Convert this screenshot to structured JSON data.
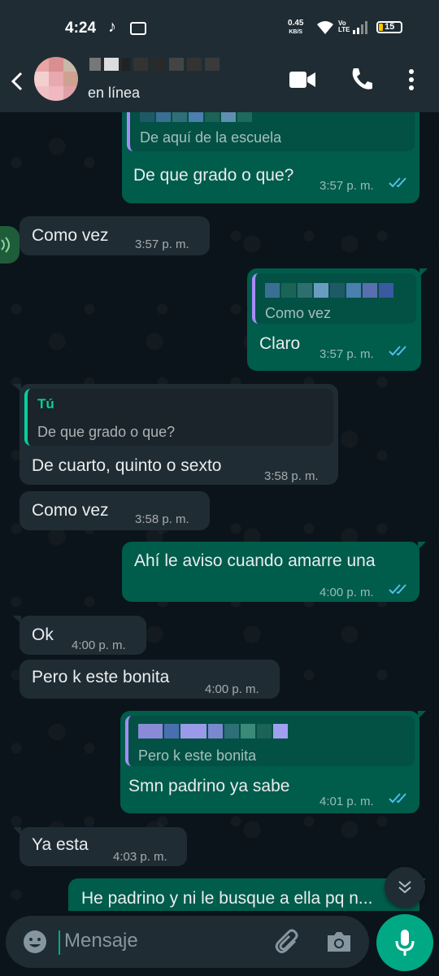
{
  "status_bar": {
    "time": "4:24",
    "net_speed_value": "0.45",
    "net_speed_unit": "KB/S",
    "volte": "Vo LTE",
    "battery": "15"
  },
  "header": {
    "status": "en línea",
    "icons": [
      "back-arrow-icon",
      "video-call-icon",
      "phone-icon",
      "more-vert-icon"
    ]
  },
  "messages": [
    {
      "dir": "out",
      "quote_text": "De aquí de la escuela",
      "text": "De que grado o que?",
      "time": "3:57 p. m.",
      "read": true
    },
    {
      "dir": "in",
      "text": "Como vez",
      "time": "3:57 p. m."
    },
    {
      "dir": "out",
      "quote_text": "Como vez",
      "text": "Claro",
      "time": "3:57 p. m.",
      "read": true
    },
    {
      "dir": "in",
      "quote_author": "Tú",
      "quote_text": "De que grado o que?",
      "text": "De cuarto, quinto o sexto",
      "time": "3:58 p. m."
    },
    {
      "dir": "in",
      "text": "Como vez",
      "time": "3:58 p. m."
    },
    {
      "dir": "out",
      "text": "Ahí le aviso cuando amarre una",
      "time": "4:00 p. m.",
      "read": true
    },
    {
      "dir": "in",
      "text": "Ok",
      "time": "4:00 p. m."
    },
    {
      "dir": "in",
      "text": "Pero k este bonita",
      "time": "4:00 p. m."
    },
    {
      "dir": "out",
      "quote_text": "Pero k este bonita",
      "text": "Smn padrino ya sabe",
      "time": "4:01 p. m.",
      "read": true
    },
    {
      "dir": "in",
      "text": "Ya esta",
      "time": "4:03 p. m."
    },
    {
      "dir": "out",
      "text": "He padrino y ni le busque a ella pq n..."
    }
  ],
  "composer": {
    "placeholder": "Mensaje"
  },
  "colors": {
    "incoming_bubble": "#202c33",
    "outgoing_bubble": "#005c4b",
    "accent": "#00a884",
    "read_ticks": "#53bdeb"
  }
}
